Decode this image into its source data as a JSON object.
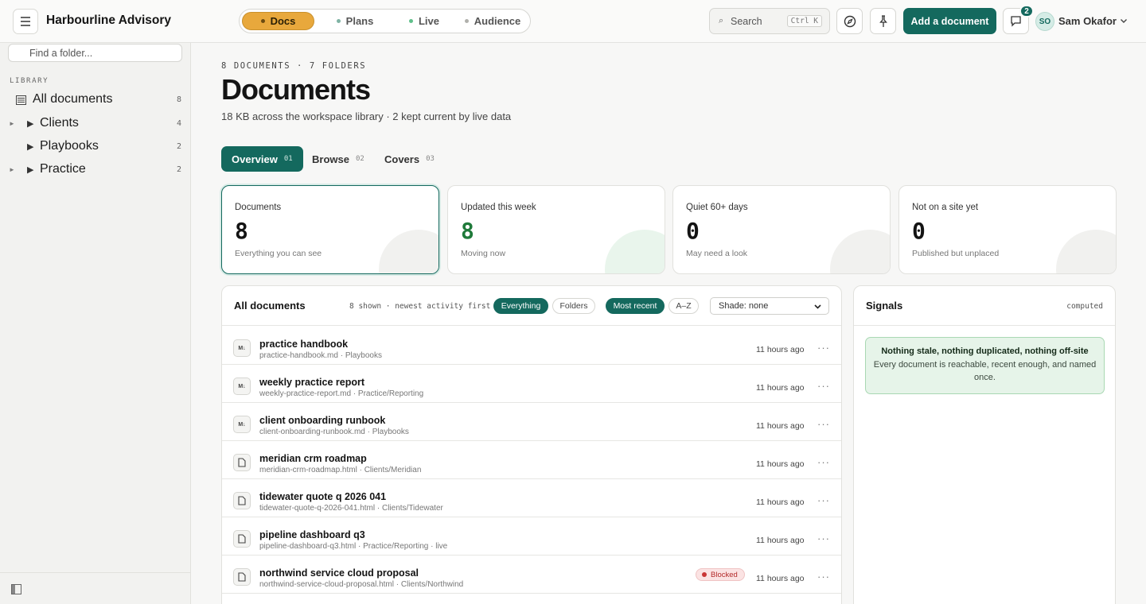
{
  "app": {
    "brand": "Harbourline Advisory"
  },
  "modes": [
    {
      "label": "Docs",
      "dot": "#6b4a10"
    },
    {
      "label": "Plans",
      "dot": "#7fb3a4"
    },
    {
      "label": "Live",
      "dot": "#5fbf8a"
    },
    {
      "label": "Audience",
      "dot": "#b0b0ac"
    }
  ],
  "search": {
    "placeholder": "Search",
    "shortcut": "Ctrl K"
  },
  "header": {
    "add_label": "Add a document",
    "notif_count": "2",
    "avatar_initials": "SO",
    "user_name": "Sam Okafor"
  },
  "sidebar": {
    "folder_search_placeholder": "Find a folder...",
    "library_label": "LIBRARY",
    "items": [
      {
        "label": "All documents",
        "count": "8"
      },
      {
        "label": "Clients",
        "count": "4"
      },
      {
        "label": "Playbooks",
        "count": "2"
      },
      {
        "label": "Practice",
        "count": "2"
      }
    ]
  },
  "page": {
    "eyebrow": "8 DOCUMENTS · 7 FOLDERS",
    "title": "Documents",
    "subtitle": "18 KB across the workspace library · 2 kept current by live data"
  },
  "tabs": [
    {
      "label": "Overview",
      "num": "01"
    },
    {
      "label": "Browse",
      "num": "02"
    },
    {
      "label": "Covers",
      "num": "03"
    }
  ],
  "stats": [
    {
      "label": "Documents",
      "value": "8",
      "note": "Everything you can see"
    },
    {
      "label": "Updated this week",
      "value": "8",
      "note": "Moving now"
    },
    {
      "label": "Quiet 60+ days",
      "value": "0",
      "note": "May need a look"
    },
    {
      "label": "Not on a site yet",
      "value": "0",
      "note": "Published but unplaced"
    }
  ],
  "list": {
    "title": "All documents",
    "shown": "8 shown · newest activity first",
    "filters": [
      "Everything",
      "Folders"
    ],
    "sorts": [
      "Most recent",
      "A–Z"
    ],
    "shade": "Shade: none",
    "rows": [
      {
        "icon": "M↓",
        "title": "practice handbook",
        "path": "practice-handbook.md · Playbooks",
        "time": "11 hours ago"
      },
      {
        "icon": "M↓",
        "title": "weekly practice report",
        "path": "weekly-practice-report.md · Practice/Reporting",
        "time": "11 hours ago"
      },
      {
        "icon": "M↓",
        "title": "client onboarding runbook",
        "path": "client-onboarding-runbook.md · Playbooks",
        "time": "11 hours ago"
      },
      {
        "icon": "",
        "title": "meridian crm roadmap",
        "path": "meridian-crm-roadmap.html · Clients/Meridian",
        "time": "11 hours ago"
      },
      {
        "icon": "",
        "title": "tidewater quote q 2026 041",
        "path": "tidewater-quote-q-2026-041.html · Clients/Tidewater",
        "time": "11 hours ago"
      },
      {
        "icon": "",
        "title": "pipeline dashboard q3",
        "path": "pipeline-dashboard-q3.html · Practice/Reporting · live",
        "time": "11 hours ago"
      },
      {
        "icon": "",
        "title": "northwind service cloud proposal",
        "path": "northwind-service-cloud-proposal.html · Clients/Northwind",
        "time": "11 hours ago",
        "status": "Blocked"
      }
    ]
  },
  "signals": {
    "title": "Signals",
    "tag": "computed",
    "ok_title": "Nothing stale, nothing duplicated, nothing off-site",
    "ok_body": "Every document is reachable, recent enough, and named once."
  },
  "colors": {
    "accent": "#14695e",
    "docs_mode": "#e8a83c",
    "ok_bg": "#e6f4e9",
    "blocked": "#c93535"
  }
}
